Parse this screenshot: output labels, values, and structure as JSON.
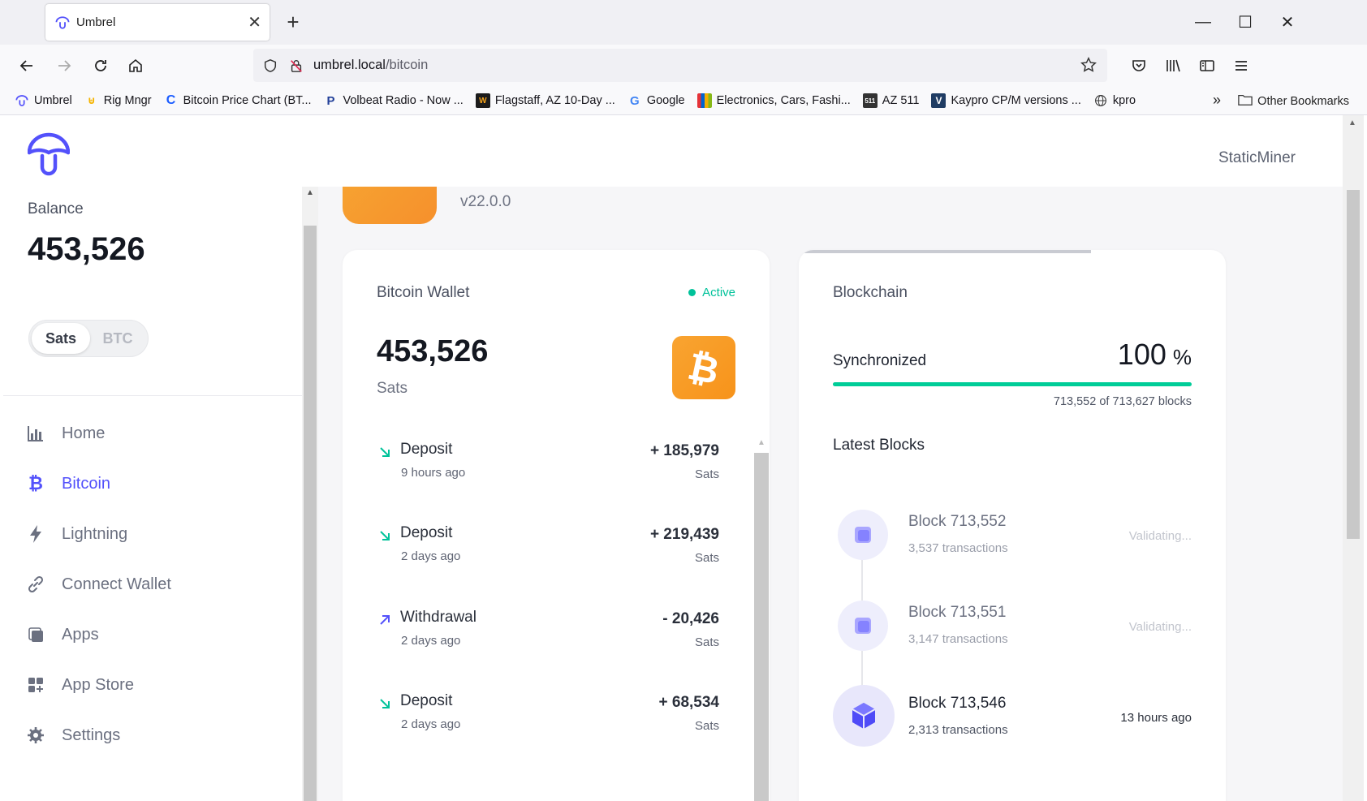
{
  "browser": {
    "tab_title": "Umbrel",
    "url_host": "umbrel.local",
    "url_path": "/bitcoin",
    "bookmarks": [
      {
        "label": "Umbrel",
        "icon": "umbrel-icon"
      },
      {
        "label": "Rig Mngr",
        "icon": "rig-icon"
      },
      {
        "label": "Bitcoin Price Chart (BT...",
        "icon": "coin-icon"
      },
      {
        "label": "Volbeat Radio - Now ...",
        "icon": "pandora-icon"
      },
      {
        "label": "Flagstaff, AZ 10-Day ...",
        "icon": "weather-icon"
      },
      {
        "label": "Google",
        "icon": "google-icon"
      },
      {
        "label": "Electronics, Cars, Fashi...",
        "icon": "ebay-icon"
      },
      {
        "label": "AZ 511",
        "icon": "az511-icon"
      },
      {
        "label": "Kaypro CP/M versions ...",
        "icon": "kaypro-icon"
      },
      {
        "label": "kpro",
        "icon": "globe-icon"
      }
    ],
    "other_bookmarks": "Other Bookmarks"
  },
  "header": {
    "username": "StaticMiner"
  },
  "sidebar": {
    "balance_label": "Balance",
    "balance_value": "453,526",
    "unit_toggle": {
      "selected": "Sats",
      "other": "BTC"
    },
    "nav": [
      {
        "label": "Home",
        "icon": "chart-icon",
        "active": false
      },
      {
        "label": "Bitcoin",
        "icon": "bitcoin-icon",
        "active": true
      },
      {
        "label": "Lightning",
        "icon": "lightning-icon",
        "active": false
      },
      {
        "label": "Connect Wallet",
        "icon": "link-icon",
        "active": false
      },
      {
        "label": "Apps",
        "icon": "apps-icon",
        "active": false
      },
      {
        "label": "App Store",
        "icon": "app-store-icon",
        "active": false
      },
      {
        "label": "Settings",
        "icon": "gear-icon",
        "active": false
      }
    ]
  },
  "app_header": {
    "version": "v22.0.0"
  },
  "wallet": {
    "title": "Bitcoin Wallet",
    "status": "Active",
    "balance": "453,526",
    "unit": "Sats",
    "transactions": [
      {
        "type": "Deposit",
        "time": "9 hours ago",
        "amount": "+ 185,979",
        "unit": "Sats",
        "direction": "in"
      },
      {
        "type": "Deposit",
        "time": "2 days ago",
        "amount": "+ 219,439",
        "unit": "Sats",
        "direction": "in"
      },
      {
        "type": "Withdrawal",
        "time": "2 days ago",
        "amount": "- 20,426",
        "unit": "Sats",
        "direction": "out"
      },
      {
        "type": "Deposit",
        "time": "2 days ago",
        "amount": "+ 68,534",
        "unit": "Sats",
        "direction": "in"
      }
    ]
  },
  "blockchain": {
    "title": "Blockchain",
    "sync_label": "Synchronized",
    "sync_percent": "100",
    "sync_percent_symbol": "%",
    "sync_fraction": 1.0,
    "blocks_text": "713,552 of 713,627 blocks",
    "latest_label": "Latest Blocks",
    "blocks": [
      {
        "name": "Block 713,552",
        "tx": "3,537 transactions",
        "status": "Validating..."
      },
      {
        "name": "Block 713,551",
        "tx": "3,147 transactions",
        "status": "Validating..."
      },
      {
        "name": "Block 713,546",
        "tx": "2,313 transactions",
        "status": "13 hours ago"
      }
    ]
  },
  "colors": {
    "accent": "#5351fb",
    "success": "#00c29a",
    "bitcoin": "#f7931a"
  }
}
